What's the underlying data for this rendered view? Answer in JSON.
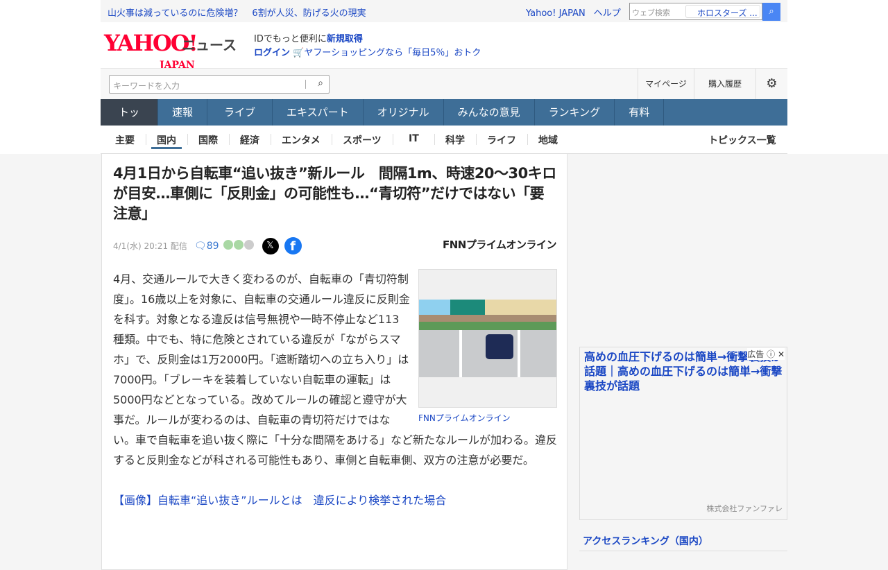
{
  "topbar": {
    "headline_1": "山火事は減っているのに危険増？",
    "headline_2": "6割が人災、防げる火の現実",
    "yahoo_japan": "Yahoo! JAPAN",
    "help": "ヘルプ",
    "web_search_placeholder": "ウェブ検索",
    "search_chip": "ホロスターズ ...",
    "accent": "#4a86f4"
  },
  "header": {
    "logo": "YAHOO! JAPAN",
    "logo_main": "YAHOO!",
    "logo_sub": "JAPAN",
    "news": "ニュース",
    "id_prefix": "IDでもっと便利に",
    "signup": "新規取得",
    "login": "ログイン",
    "shopping": "ヤフーショッピングなら「毎日5％」おトク"
  },
  "search": {
    "placeholder": "キーワードを入力",
    "mypage": "マイページ",
    "history": "購入履歴"
  },
  "nav": {
    "items": [
      "トップ",
      "速報",
      "ライブ",
      "エキスパート",
      "オリジナル",
      "みんなの意見",
      "ランキング",
      "有料"
    ],
    "color": "#3e6e97"
  },
  "subnav": {
    "items": [
      "主要",
      "国内",
      "国際",
      "経済",
      "エンタメ",
      "スポーツ",
      "IT",
      "科学",
      "ライフ",
      "地域"
    ],
    "active": "国内",
    "topics": "トピックス一覧"
  },
  "article": {
    "title": "4月1日から自転車“追い抜き”新ルール　間隔1m、時速20〜30キロが目安…車側に「反則金」の可能性も…“青切符”だけではない「要注意」",
    "date": "4/1(水) 20:21",
    "delivered": "配信",
    "comments": "89",
    "source": "FNNプライムオンライン",
    "body": "4月、交通ルールで大きく変わるのが、自転車の「青切符制度」。16歳以上を対象に、自転車の交通ルール違反に反則金を科す。対象となる違反は信号無視や一時不停止など113種類。中でも、特に危険とされている違反が「ながらスマホ」で、反則金は1万2000円。「遮断踏切への立ち入り」は7000円。「ブレーキを装着していない自転車の運転」は5000円などとなっている。改めてルールの確認と遵守が大事だ。ルールが変わるのは、自転車の青切符だけではない。車で自転車を追い抜く際に「十分な間隔をあける」など新たなルールが加わる。違反すると反則金などが科される可能性もあり、車側と自転車側、双方の注意が必要だ。",
    "image_caption": "FNNプライムオンライン",
    "image_link": "【画像】自転車“追い抜き”ルールとは　違反により検挙された場合"
  },
  "ad": {
    "label": "広告",
    "title": "高めの血圧下げるのは簡単→衝撃裏技が話題｜高めの血圧下げるのは簡単→衝撃裏技が話題",
    "advertiser": "株式会社ファンファレ"
  },
  "ranking": {
    "title": "アクセスランキング（国内）"
  }
}
